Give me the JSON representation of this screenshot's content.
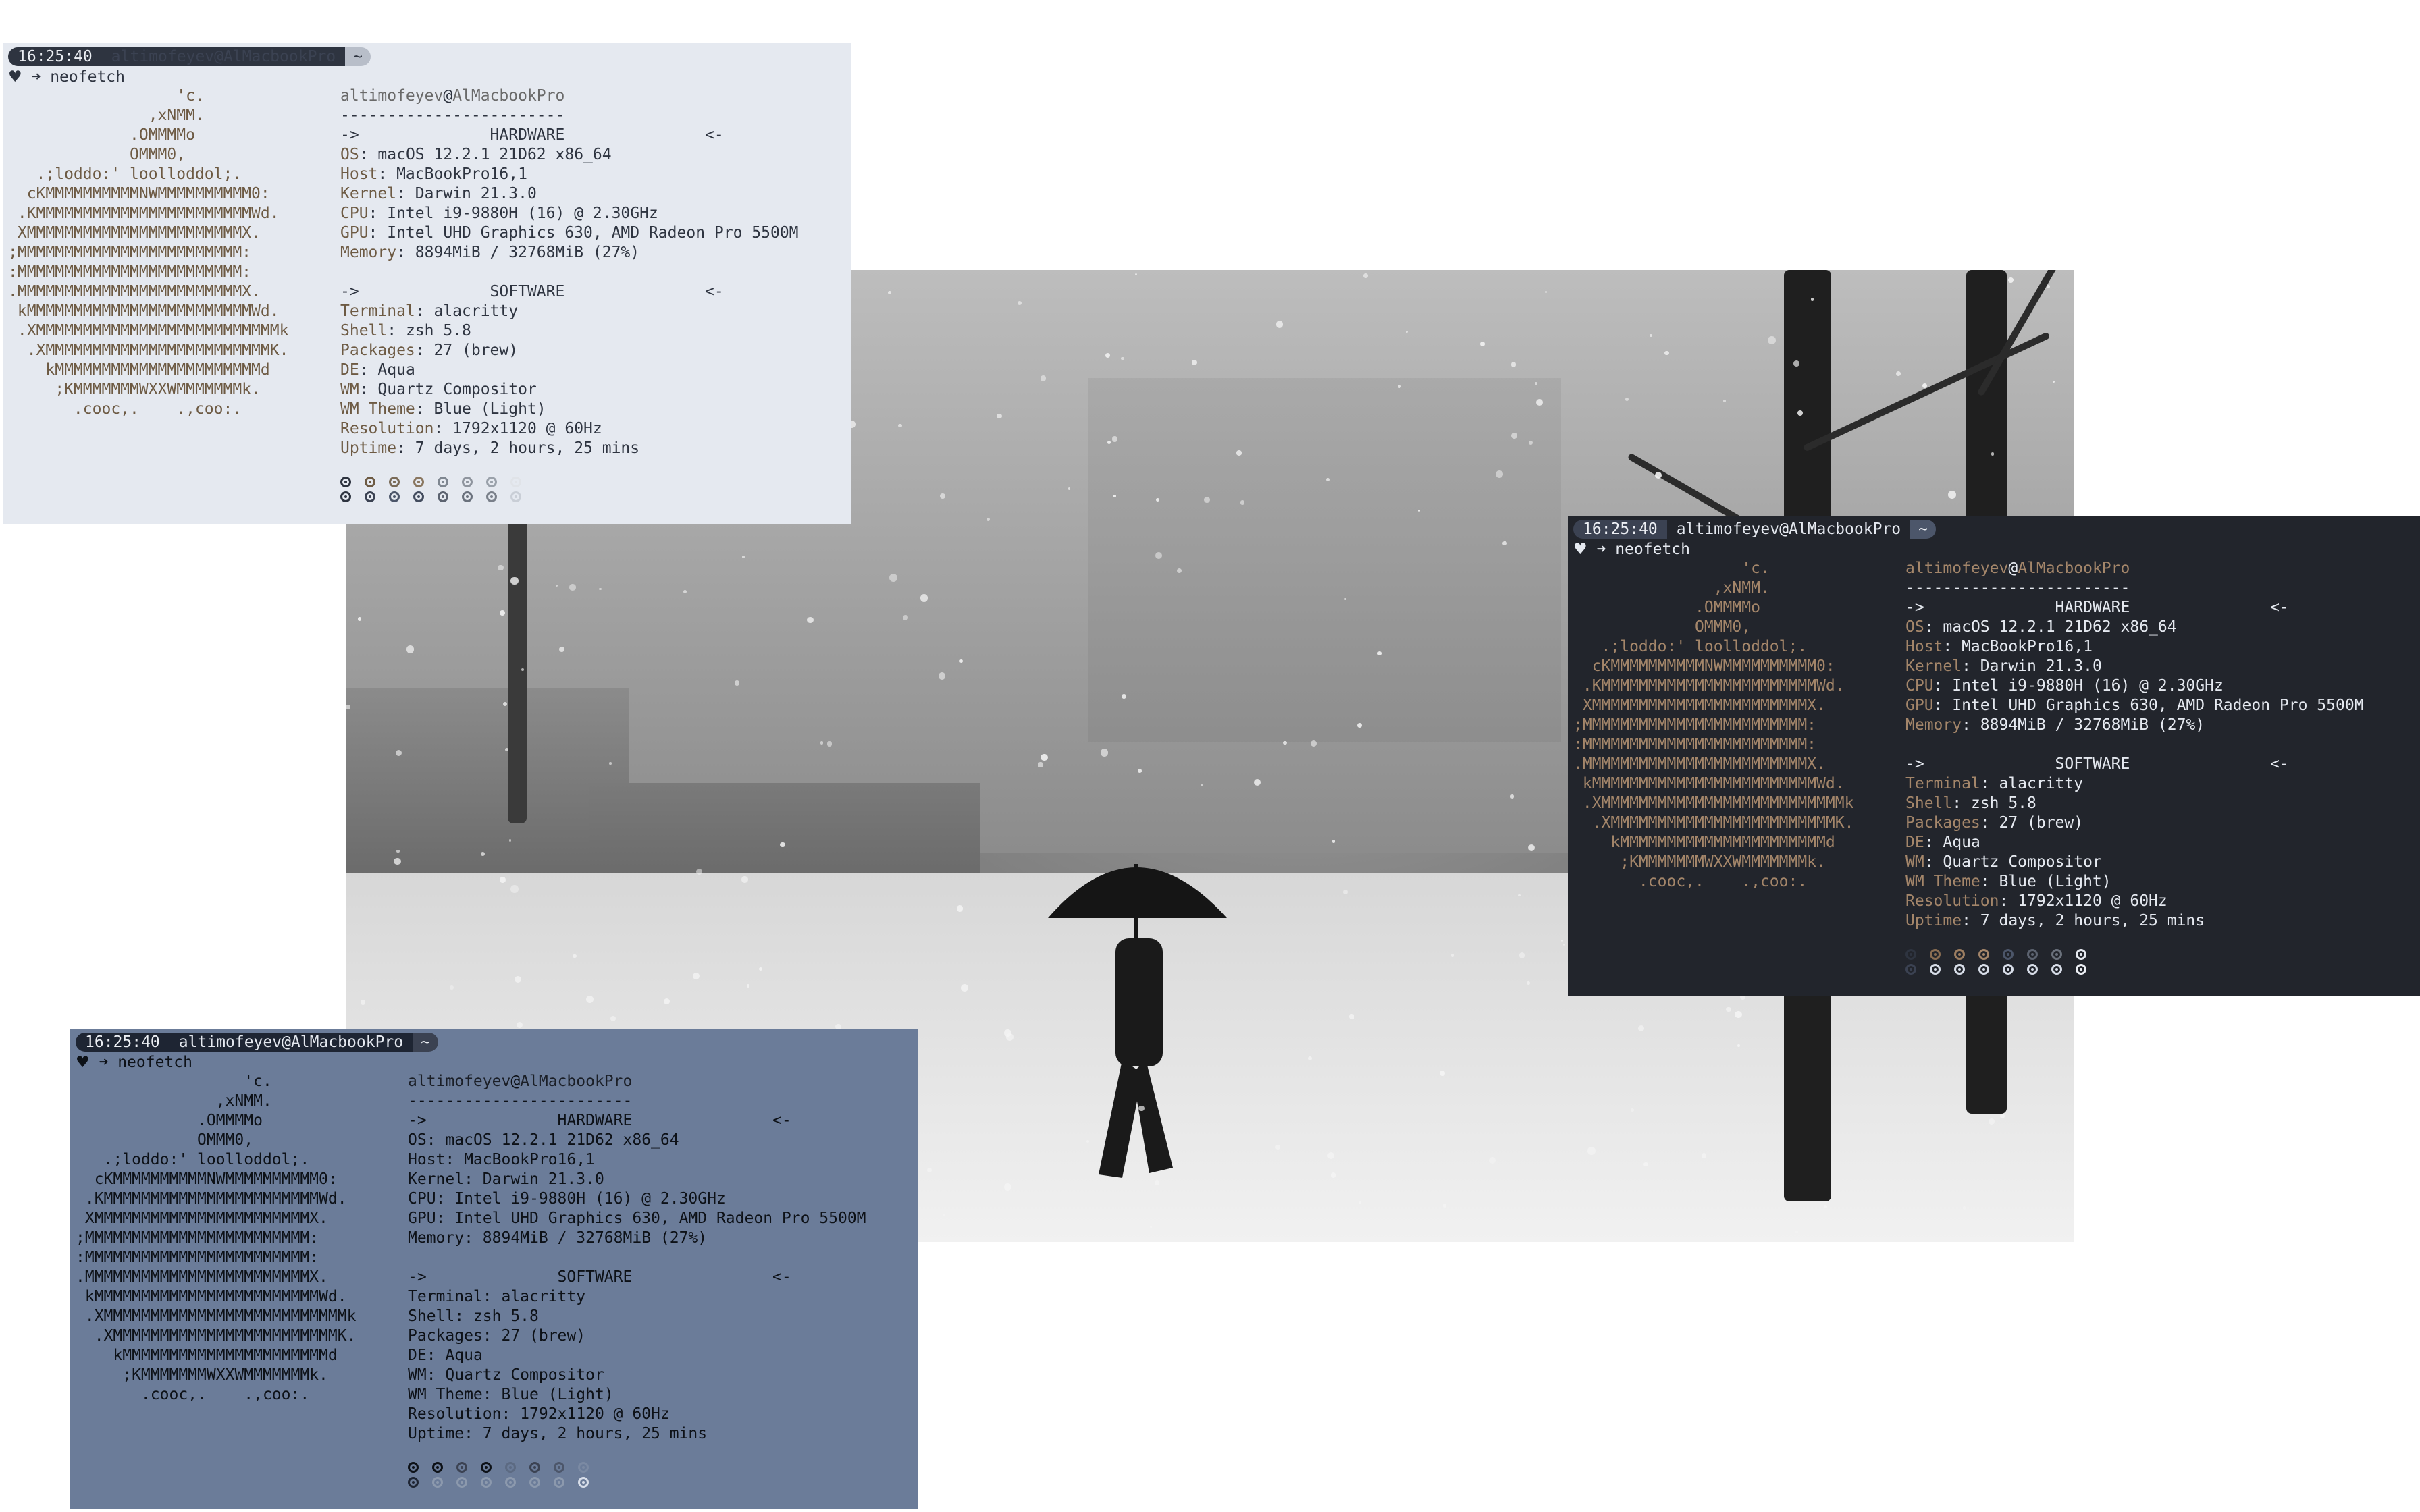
{
  "prompt": {
    "time": "16:25:40",
    "user_host": "altimofeyev@AlMacbookPro",
    "dir": "~",
    "heart": "♥",
    "arrow": "➜",
    "command": "neofetch"
  },
  "art": [
    "                  'c.",
    "               ,xNMM.",
    "             .OMMMMo",
    "             OMMM0,",
    "   .;loddo:' loolloddol;.",
    "  cKMMMMMMMMMMNWMMMMMMMMMM0:",
    " .KMMMMMMMMMMMMMMMMMMMMMMMWd.",
    " XMMMMMMMMMMMMMMMMMMMMMMMX.",
    ";MMMMMMMMMMMMMMMMMMMMMMMM:",
    ":MMMMMMMMMMMMMMMMMMMMMMMM:",
    ".MMMMMMMMMMMMMMMMMMMMMMMMX.",
    " kMMMMMMMMMMMMMMMMMMMMMMMMWd.",
    " .XMMMMMMMMMMMMMMMMMMMMMMMMMMk",
    "  .XMMMMMMMMMMMMMMMMMMMMMMMMK.",
    "    kMMMMMMMMMMMMMMMMMMMMMMd",
    "     ;KMMMMMMMWXXWMMMMMMMk.",
    "       .cooc,.    .,coo:."
  ],
  "info": {
    "user": "altimofeyev",
    "at": "@",
    "host": "AlMacbookPro",
    "separator": "------------------------",
    "hardware_header": "->              HARDWARE               <-",
    "software_header": "->              SOFTWARE               <-",
    "hardware": [
      {
        "key": "OS",
        "value": ": macOS 12.2.1 21D62 x86_64"
      },
      {
        "key": "Host",
        "value": ": MacBookPro16,1"
      },
      {
        "key": "Kernel",
        "value": ": Darwin 21.3.0"
      },
      {
        "key": "CPU",
        "value": ": Intel i9-9880H (16) @ 2.30GHz"
      },
      {
        "key": "GPU",
        "value": ": Intel UHD Graphics 630, AMD Radeon Pro 5500M"
      },
      {
        "key": "Memory",
        "value": ": 8894MiB / 32768MiB (27%)"
      }
    ],
    "software": [
      {
        "key": "Terminal",
        "value": ": alacritty"
      },
      {
        "key": "Shell",
        "value": ": zsh 5.8"
      },
      {
        "key": "Packages",
        "value": ": 27 (brew)"
      },
      {
        "key": "DE",
        "value": ": Aqua"
      },
      {
        "key": "WM",
        "value": ": Quartz Compositor"
      },
      {
        "key": "WM Theme",
        "value": ": Blue (Light)"
      },
      {
        "key": "Resolution",
        "value": ": 1792x1120 @ 60Hz"
      },
      {
        "key": "Uptime",
        "value": ": 7 days, 2 hours, 25 mins"
      }
    ]
  },
  "themes": {
    "light": {
      "bg": "#e5e9f0",
      "fg": "#2e3440",
      "accent": "#6d5a43",
      "palette_top": [
        "#2e3440",
        "#6d5a43",
        "#7a6b58",
        "#8a7760",
        "#7f8791",
        "#8f959e",
        "#9aa1aa",
        "#e0e3e8"
      ],
      "palette_bottom": [
        "#2e3440",
        "#3b4252",
        "#4c566a",
        "#434c5e",
        "#5c6370",
        "#6a717c",
        "#7a808a",
        "#c9ced6"
      ]
    },
    "dark": {
      "bg": "#22252c",
      "fg": "#e5e9f0",
      "accent": "#a4866a",
      "palette_top": [
        "#2e3440",
        "#8a6d52",
        "#9c7d60",
        "#a4866a",
        "#4c566a",
        "#5c6370",
        "#6a717c",
        "#e5e9f0"
      ],
      "palette_bottom": [
        "#3b4252",
        "#d8dee9",
        "#d8dee9",
        "#d8dee9",
        "#d8dee9",
        "#d8dee9",
        "#d8dee9",
        "#eceff4"
      ]
    },
    "blue": {
      "bg": "#6b7c99",
      "fg": "#0d1117",
      "accent": "#0d1117",
      "palette_top": [
        "#0d1117",
        "#0d1117",
        "#3b4252",
        "#0d1117",
        "#5c6a82",
        "#3b4252",
        "#4c566a",
        "#7b8aa3"
      ],
      "palette_bottom": [
        "#1e2533",
        "#8c99ad",
        "#8c99ad",
        "#8c99ad",
        "#8c99ad",
        "#8c99ad",
        "#8c99ad",
        "#d8dee9"
      ]
    }
  }
}
